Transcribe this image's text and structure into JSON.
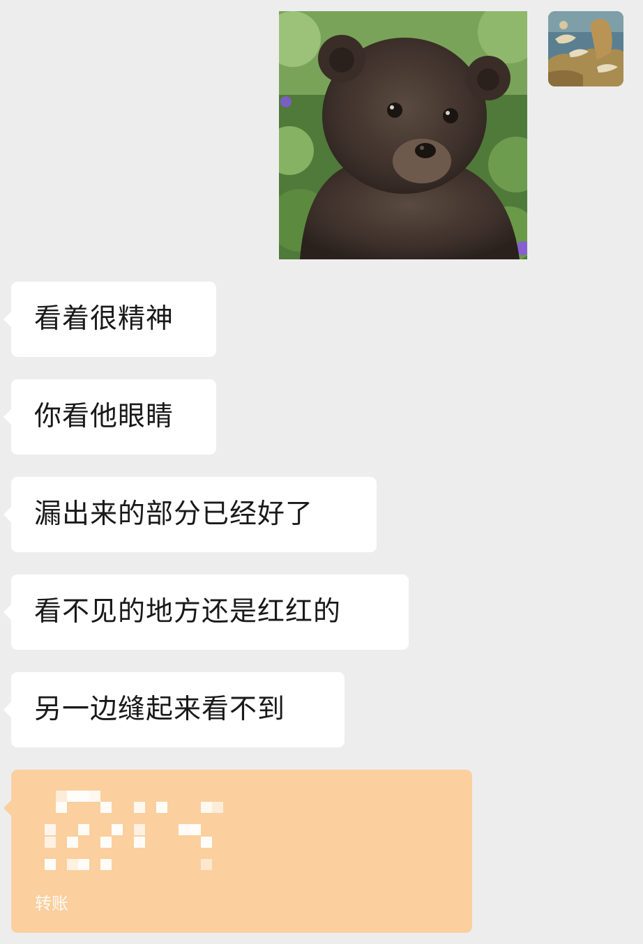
{
  "messages": [
    {
      "text": "看着很精神"
    },
    {
      "text": "你看他眼睛"
    },
    {
      "text": "漏出来的部分已经好了"
    },
    {
      "text": "看不见的地方还是红红的"
    },
    {
      "text": "另一边缝起来看不到"
    }
  ],
  "transfer": {
    "footer_label": "转账",
    "color": "#fbcf9e"
  },
  "icons": {
    "avatar": "landscape-painting-avatar",
    "photo": "bear-cub-photo"
  }
}
